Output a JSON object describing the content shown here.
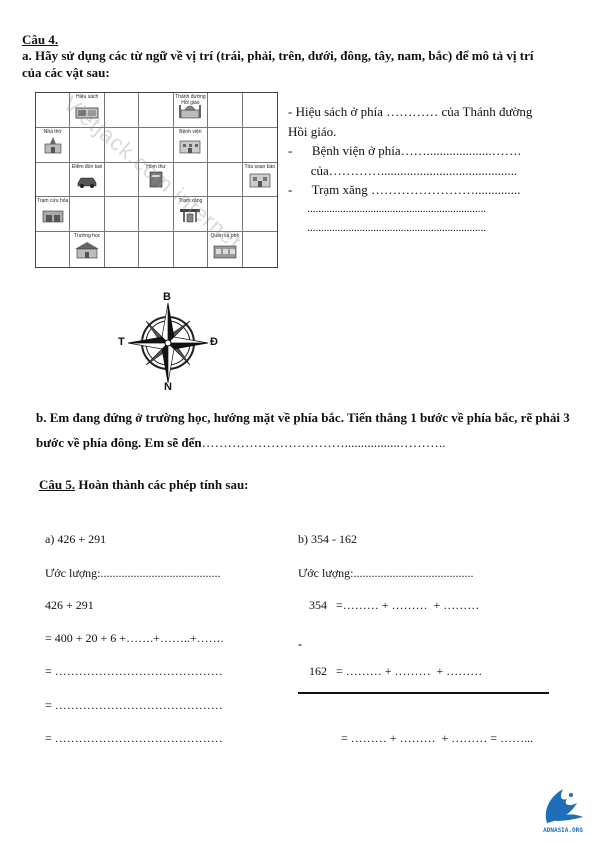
{
  "q4": {
    "title": "Câu 4.",
    "prompt_a": "a. Hãy sử dụng các từ ngữ về vị trí (trái, phải, trên, dưới, đông, tây, nam, bắc) để mô tả vị trí của các vật sau:",
    "map_cells": [
      {
        "label": "",
        "icon": ""
      },
      {
        "label": "Hiệu sách",
        "icon": "bookstore"
      },
      {
        "label": "",
        "icon": ""
      },
      {
        "label": "",
        "icon": ""
      },
      {
        "label": "Thánh đường Hồi giáo",
        "icon": "mosque"
      },
      {
        "label": "",
        "icon": ""
      },
      {
        "label": "",
        "icon": ""
      },
      {
        "label": "Nhà thờ",
        "icon": "church"
      },
      {
        "label": "",
        "icon": ""
      },
      {
        "label": "",
        "icon": ""
      },
      {
        "label": "",
        "icon": ""
      },
      {
        "label": "Bệnh viện",
        "icon": "hospital"
      },
      {
        "label": "",
        "icon": ""
      },
      {
        "label": "",
        "icon": ""
      },
      {
        "label": "",
        "icon": ""
      },
      {
        "label": "Điểm đón taxi",
        "icon": "taxi"
      },
      {
        "label": "",
        "icon": ""
      },
      {
        "label": "Hòm thư",
        "icon": "mailbox"
      },
      {
        "label": "",
        "icon": ""
      },
      {
        "label": "",
        "icon": ""
      },
      {
        "label": "Tòa soạn báo",
        "icon": "newspaper-office"
      },
      {
        "label": "Trạm cứu hỏa",
        "icon": "fire-station"
      },
      {
        "label": "",
        "icon": ""
      },
      {
        "label": "",
        "icon": ""
      },
      {
        "label": "",
        "icon": ""
      },
      {
        "label": "Trạm xăng",
        "icon": "gas-station"
      },
      {
        "label": "",
        "icon": ""
      },
      {
        "label": "",
        "icon": ""
      },
      {
        "label": "",
        "icon": ""
      },
      {
        "label": "Trường học",
        "icon": "school"
      },
      {
        "label": "",
        "icon": ""
      },
      {
        "label": "",
        "icon": ""
      },
      {
        "label": "",
        "icon": ""
      },
      {
        "label": "Quán cà phê",
        "icon": "cafe"
      },
      {
        "label": "",
        "icon": ""
      }
    ],
    "answers": [
      "- Hiệu sách ở phía ………… của Thánh đường",
      "Hồi giáo.",
      "-      Bệnh viện ở phía……....................…….",
      "       của…………..........................................",
      "-      Trạm xăng ……………………..............",
      "       .................................................................",
      "       ................................................................."
    ],
    "compass": {
      "north": "B",
      "south": "N",
      "west": "T",
      "east": "Đ"
    },
    "prompt_b": "b. Em đang đứng ở trường học, hướng mặt về phía bắc. Tiến thẳng 1 bước về phía bắc, rẽ phải 3 bước về phía đông. Em sẽ đến",
    "prompt_b_blank": "…………………………….................……….."
  },
  "q5": {
    "title": "Câu 5.",
    "prompt": " Hoàn thành các phép tính sau:",
    "left": {
      "expr": "a) 426 + 291",
      "estimate": "Ước lượng:........................................",
      "line1": "426 + 291",
      "line2": "= 400 + 20 + 6 +…….+……..+…….",
      "line3": "= ……………………………………",
      "line4": "= ……………………………………",
      "line5": "= ……………………………………"
    },
    "right": {
      "expr": "b) 354 - 162",
      "estimate": "Ước lượng:........................................",
      "line1": "354   =……… + ………  + ………",
      "minus": "-",
      "line2": "162   = ……… + ………  + ………",
      "line3": "= ……… + ………  + ……… = ……..."
    }
  },
  "logo": {
    "text": "ADNASIA.ORG",
    "color": "#1f6fb8"
  },
  "watermark": "Vietjack.com internet"
}
